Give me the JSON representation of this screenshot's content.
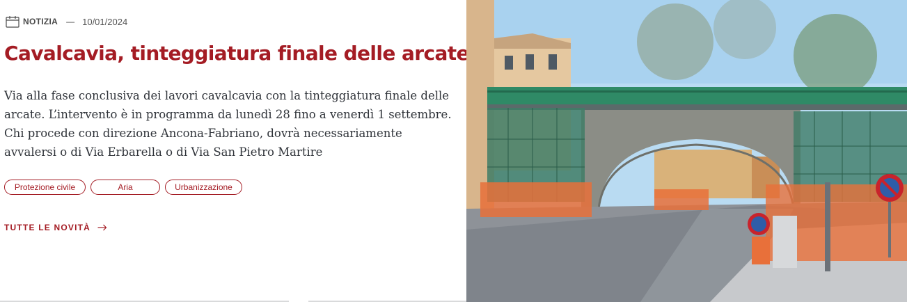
{
  "news": {
    "category": "NOTIZIA",
    "separator": "—",
    "date": "10/01/2024",
    "title": "Cavalcavia, tinteggiatura finale delle arcate",
    "description": "Via alla fase conclusiva dei lavori cavalcavia con la tinteggiatura finale delle arcate. L’intervento è in programma da lunedì 28 fino a venerdì 1 settembre. Chi procede con direzione Ancona-Fabriano, dovrà necessariamente avvalersi o di Via Erbarella o di Via San Pietro Martire",
    "tags": [
      "Protezione civile",
      "Aria",
      "Urbanizzazione"
    ],
    "all_news_label": "TUTTE LE NOVITÀ"
  },
  "icons": {
    "calendar": "calendar-icon",
    "arrow": "arrow-right-icon"
  },
  "colors": {
    "accent": "#a41c24",
    "text": "#30343a",
    "meta": "#4a4a4a"
  }
}
